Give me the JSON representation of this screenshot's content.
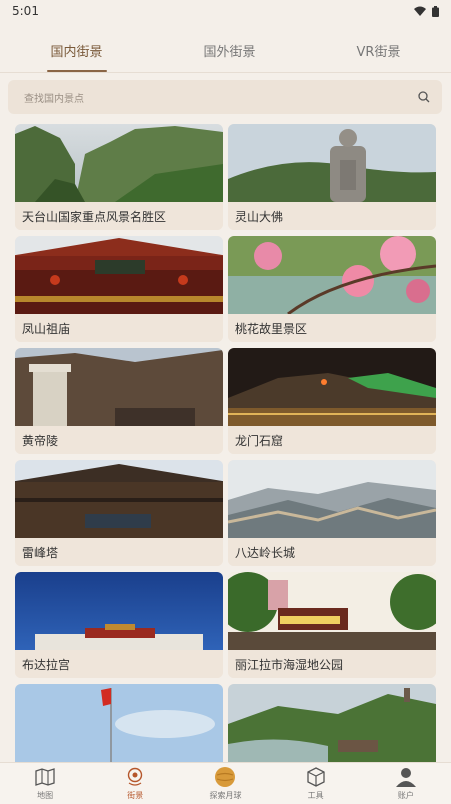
{
  "status": {
    "time": "5:01",
    "icons": [
      "wifi-icon",
      "battery-icon"
    ]
  },
  "tabs": [
    {
      "label": "国内街景",
      "active": true
    },
    {
      "label": "国外街景",
      "active": false
    },
    {
      "label": "VR街景",
      "active": false
    }
  ],
  "search": {
    "placeholder": "查找国内景点",
    "icon": "search-icon"
  },
  "places": [
    {
      "label": "天台山国家重点风景名胜区"
    },
    {
      "label": "灵山大佛"
    },
    {
      "label": "凤山祖庙"
    },
    {
      "label": "桃花故里景区"
    },
    {
      "label": "黄帝陵"
    },
    {
      "label": "龙门石窟"
    },
    {
      "label": "雷峰塔"
    },
    {
      "label": "八达岭长城"
    },
    {
      "label": "布达拉宫"
    },
    {
      "label": "丽江拉市海湿地公园"
    },
    {
      "label": ""
    },
    {
      "label": ""
    }
  ],
  "bottom_nav": [
    {
      "label": "地图",
      "icon": "map-icon",
      "active": false
    },
    {
      "label": "街景",
      "icon": "streetview-pin-icon",
      "active": true
    },
    {
      "label": "探索月球",
      "icon": "moon-icon",
      "active": false
    },
    {
      "label": "工具",
      "icon": "cube-icon",
      "active": false
    },
    {
      "label": "账户",
      "icon": "user-icon",
      "active": false
    }
  ],
  "colors": {
    "accent": "#8a6545",
    "active_nav": "#b5562b",
    "background": "#f4efe9"
  }
}
